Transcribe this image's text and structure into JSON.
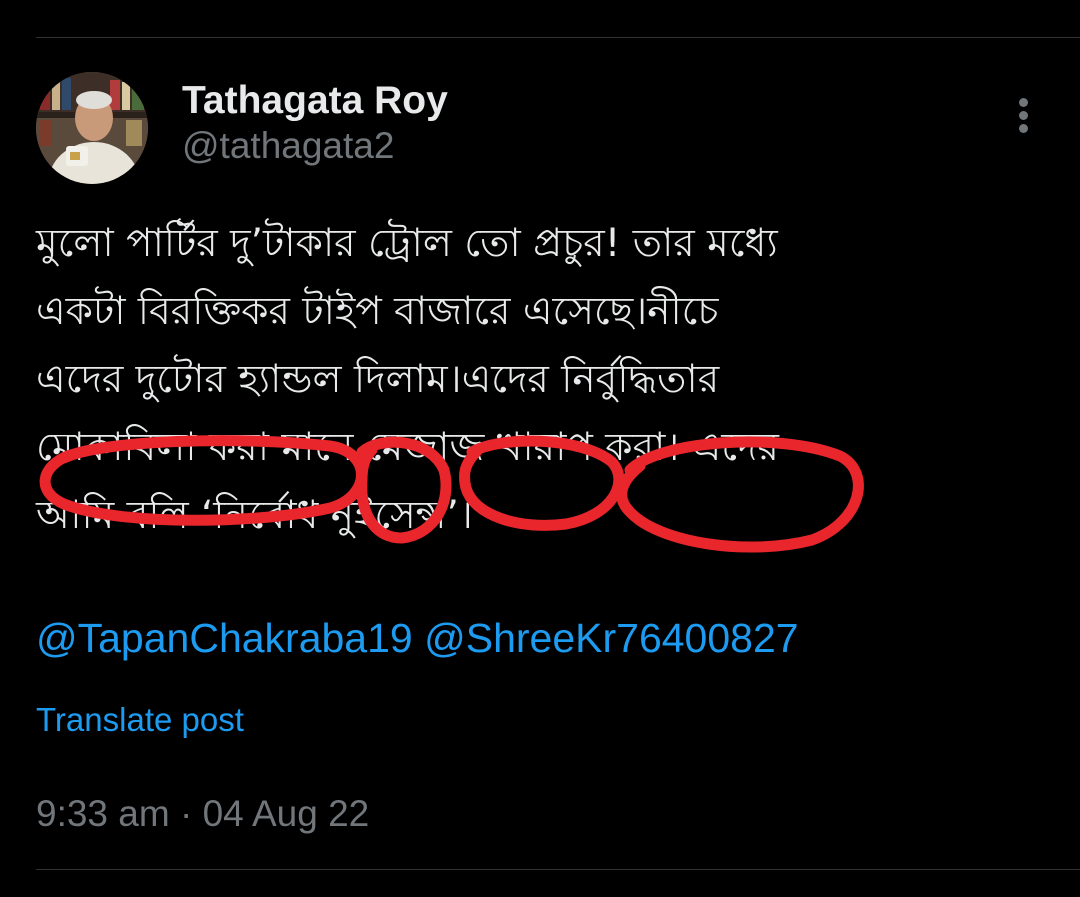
{
  "author": {
    "display_name": "Tathagata Roy",
    "handle": "@tathagata2"
  },
  "post": {
    "lines": [
      "মুলো পার্টির দু’টাকার ট্রোল তো প্রচুর! তার মধ্যে",
      "একটা বিরক্তিকর টাইপ বাজারে এসেছে।নীচে",
      "এদের দুটোর হ্যান্ডল দিলাম।এদের নির্বুদ্ধিতার",
      "মোকাবিলা করা মানে মেজাজ খারাপ করা। এদের",
      "আমি বলি ‘নির্বোধ নুইসেন্স’।"
    ],
    "mentions": [
      "@TapanChakraba19",
      "@ShreeKr76400827"
    ]
  },
  "translate_label": "Translate post",
  "timestamp": "9:33 am · 04 Aug 22",
  "icons": {
    "more": "more-vertical-icon",
    "avatar": "profile-photo"
  },
  "colors": {
    "background": "#000000",
    "text": "#e7e9ea",
    "secondary": "#71767b",
    "link": "#1d9bf0",
    "annotation": "#e8262b"
  }
}
